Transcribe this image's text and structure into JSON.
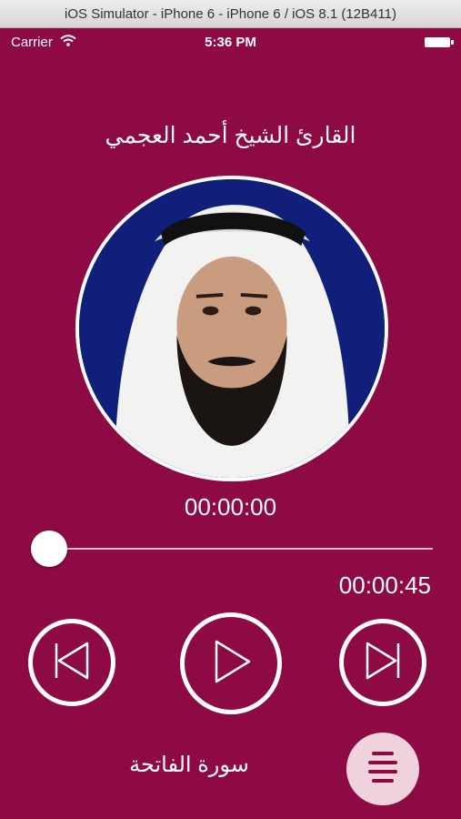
{
  "window": {
    "title": "iOS Simulator - iPhone 6 - iPhone 6 / iOS 8.1 (12B411)"
  },
  "status_bar": {
    "carrier": "Carrier",
    "time": "5:36 PM",
    "wifi_icon": "wifi-icon",
    "battery_icon": "battery-icon"
  },
  "player": {
    "reciter_name": "القارئ الشيخ أحمد العجمي",
    "elapsed": "00:00:00",
    "duration": "00:00:45",
    "progress": 0.04,
    "surah_name": "سورة الفاتحة",
    "controls": {
      "previous_icon": "skip-previous-icon",
      "play_icon": "play-icon",
      "next_icon": "skip-next-icon",
      "menu_icon": "menu-icon"
    }
  },
  "colors": {
    "background": "#8e0a45",
    "accent": "#ffffff",
    "menu_button": "#efd2dc",
    "portrait_backdrop": "#10207a"
  }
}
